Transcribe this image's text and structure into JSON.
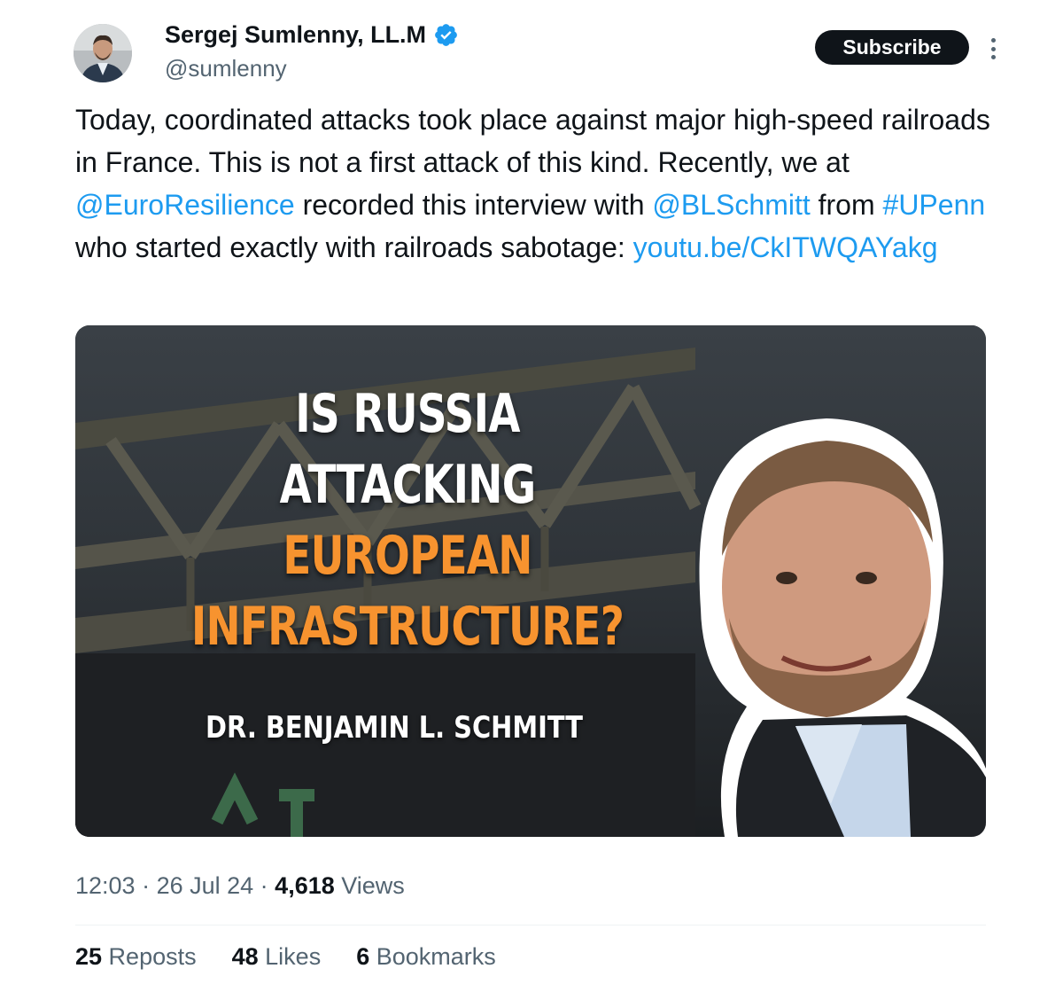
{
  "author": {
    "name": "Sergej Sumlenny, LL.M",
    "handle": "@sumlenny",
    "verified": true
  },
  "subscribe_label": "Subscribe",
  "tweet": {
    "parts": [
      {
        "text": "Today, coordinated attacks took place against major high-speed railroads in France. This is not a first attack of this kind. Recently, we at ",
        "link": false
      },
      {
        "text": "@EuroResilience",
        "link": true
      },
      {
        "text": " recorded this interview with ",
        "link": false
      },
      {
        "text": "@BLSchmitt",
        "link": true
      },
      {
        "text": " from ",
        "link": false
      },
      {
        "text": "#UPenn",
        "link": true
      },
      {
        "text": " who started exactly with railroads sabotage: ",
        "link": false
      },
      {
        "text": "youtu.be/CkITWQAYakg",
        "link": true
      }
    ]
  },
  "media": {
    "headline_white_1": "IS RUSSIA",
    "headline_white_2": "ATTACKING",
    "headline_orange_1": "EUROPEAN",
    "headline_orange_2": "INFRASTRUCTURE?",
    "guest": "DR. BENJAMIN L. SCHMITT"
  },
  "meta": {
    "time": "12:03",
    "sep1": " · ",
    "date": "26 Jul 24",
    "sep2": " · ",
    "views_count": "4,618",
    "views_label": " Views"
  },
  "stats": {
    "reposts_count": "25",
    "reposts_label": " Reposts",
    "likes_count": "48",
    "likes_label": " Likes",
    "bookmarks_count": "6",
    "bookmarks_label": " Bookmarks"
  },
  "colors": {
    "link": "#1d9bf0",
    "secondary_text": "#536471",
    "primary_text": "#0f1419",
    "headline_orange": "#f7932f"
  },
  "icons": [
    "avatar",
    "verified-badge-icon",
    "more-options-icon"
  ]
}
